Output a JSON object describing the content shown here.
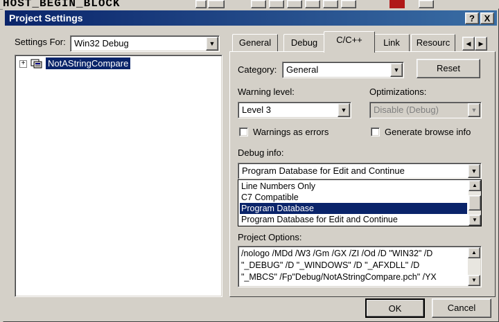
{
  "background": {
    "code_text": "HOST_BEGIN_BLOCK"
  },
  "dialog": {
    "title": "Project Settings",
    "help_button": "?",
    "close_button": "X"
  },
  "left": {
    "settings_for_label": "Settings For:",
    "settings_for_value": "Win32 Debug",
    "tree_item": "NotAStringCompare",
    "tree_expand": "+"
  },
  "tabs": [
    "General",
    "Debug",
    "C/C++",
    "Link",
    "Resourc"
  ],
  "active_tab": "C/C++",
  "cpp": {
    "category_label": "Category:",
    "category_value": "General",
    "reset_button": "Reset",
    "warning_level_label": "Warning level:",
    "warning_level_value": "Level 3",
    "optimizations_label": "Optimizations:",
    "optimizations_value": "Disable (Debug)",
    "warnings_as_errors_label": "Warnings as errors",
    "browse_info_label": "Generate browse info",
    "debug_info_label": "Debug info:",
    "debug_info_value": "Program Database for Edit and Continue",
    "debug_info_options": [
      "Line Numbers Only",
      "C7 Compatible",
      "Program Database",
      "Program Database for Edit and Continue"
    ],
    "debug_info_selected_index": 2,
    "project_options_label": "Project Options:",
    "project_options_lines": [
      "/nologo /MDd /W3 /Gm /GX /ZI /Od /D \"WIN32\" /D",
      "\"_DEBUG\" /D \"_WINDOWS\" /D \"_AFXDLL\" /D",
      "\"_MBCS\" /Fp\"Debug/NotAStringCompare.pch\" /YX"
    ]
  },
  "buttons": {
    "ok": "OK",
    "cancel": "Cancel"
  },
  "colors": {
    "titlebar": "#0a246a",
    "selection": "#0a246a",
    "face": "#d4d0c8"
  }
}
